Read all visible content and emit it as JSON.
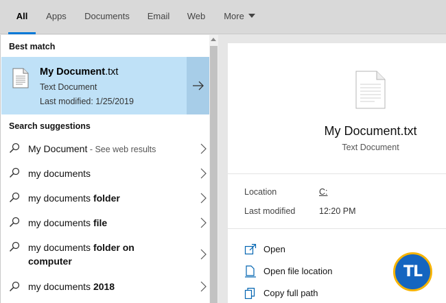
{
  "tabs": [
    {
      "label": "All"
    },
    {
      "label": "Apps"
    },
    {
      "label": "Documents"
    },
    {
      "label": "Email"
    },
    {
      "label": "Web"
    },
    {
      "label": "More"
    }
  ],
  "best_match": {
    "heading": "Best match",
    "title_bold": "My Document",
    "title_rest": ".txt",
    "type": "Text Document",
    "modified": "Last modified: 1/25/2019"
  },
  "suggestions": {
    "heading": "Search suggestions",
    "items": [
      {
        "plain": "My Document",
        "bold": "",
        "hint": " - See web results",
        "line2": ""
      },
      {
        "plain": "my documents",
        "bold": "",
        "hint": "",
        "line2": ""
      },
      {
        "plain": "my documents ",
        "bold": "folder",
        "hint": "",
        "line2": ""
      },
      {
        "plain": "my documents ",
        "bold": "file",
        "hint": "",
        "line2": ""
      },
      {
        "plain": "my documents ",
        "bold": "folder on",
        "hint": "",
        "line2": "computer"
      },
      {
        "plain": "my documents ",
        "bold": "2018",
        "hint": "",
        "line2": ""
      }
    ]
  },
  "preview": {
    "name": "My Document.txt",
    "type": "Text Document",
    "location_label": "Location",
    "location_value": "C:",
    "modified_label": "Last modified",
    "modified_value": "12:20 PM",
    "actions": [
      {
        "label": "Open"
      },
      {
        "label": "Open file location"
      },
      {
        "label": "Copy full path"
      }
    ]
  },
  "watermark": {
    "text": "TL"
  },
  "colors": {
    "accent": "#0078d7",
    "selection": "#bfe1f7",
    "selection_arrow": "#a7cde8"
  }
}
